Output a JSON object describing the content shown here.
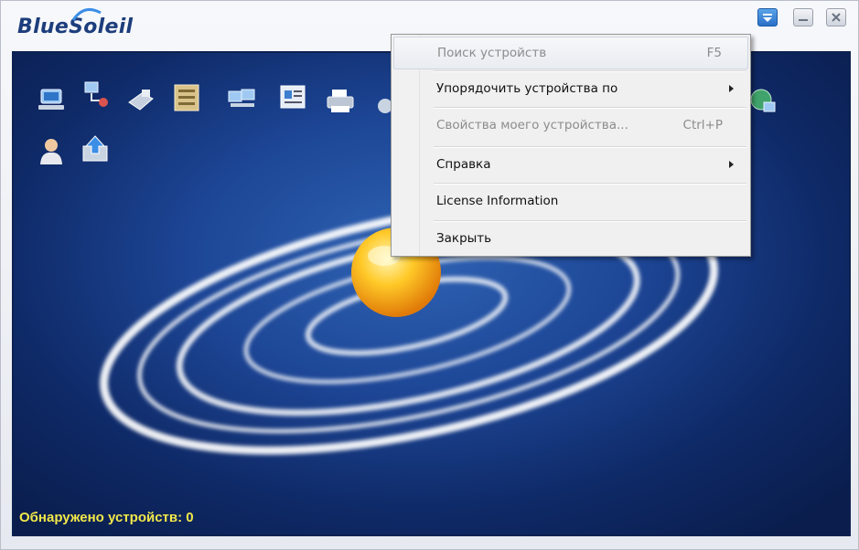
{
  "app": {
    "logo_text": "BlueSoleil"
  },
  "titlebar": {
    "buttons": [
      {
        "name": "menu-dropdown",
        "icon": "dropdown-menu-icon"
      },
      {
        "name": "minimize",
        "icon": "minimize-icon"
      },
      {
        "name": "close",
        "icon": "close-icon"
      }
    ]
  },
  "devices": {
    "icons": [
      "network-access-icon",
      "lan-connection-icon",
      "fax-icon",
      "file-transfer-icon",
      "desktop-computers-icon",
      "business-card-icon",
      "printer-icon",
      "hidden-icon",
      "network-share-icon",
      "user-icon",
      "upload-icon"
    ]
  },
  "status": {
    "text": "Обнаружено устройств: 0"
  },
  "context_menu": {
    "items": [
      {
        "label": "Поиск устройств",
        "shortcut": "F5",
        "disabled": true,
        "submenu": false
      },
      {
        "label": "Упорядочить устройства по",
        "shortcut": "",
        "disabled": false,
        "submenu": true
      },
      {
        "label": "Свойства моего устройства...",
        "shortcut": "Ctrl+P",
        "disabled": true,
        "submenu": false
      },
      {
        "label": "Справка",
        "shortcut": "",
        "disabled": false,
        "submenu": true
      },
      {
        "label": "License Information",
        "shortcut": "",
        "disabled": false,
        "submenu": false
      },
      {
        "label": "Закрыть",
        "shortcut": "",
        "disabled": false,
        "submenu": false
      }
    ]
  },
  "colors": {
    "background_deep_blue": "#0f2a68",
    "status_text": "#f2e84a",
    "menu_disabled_text": "#8c8c8c"
  }
}
